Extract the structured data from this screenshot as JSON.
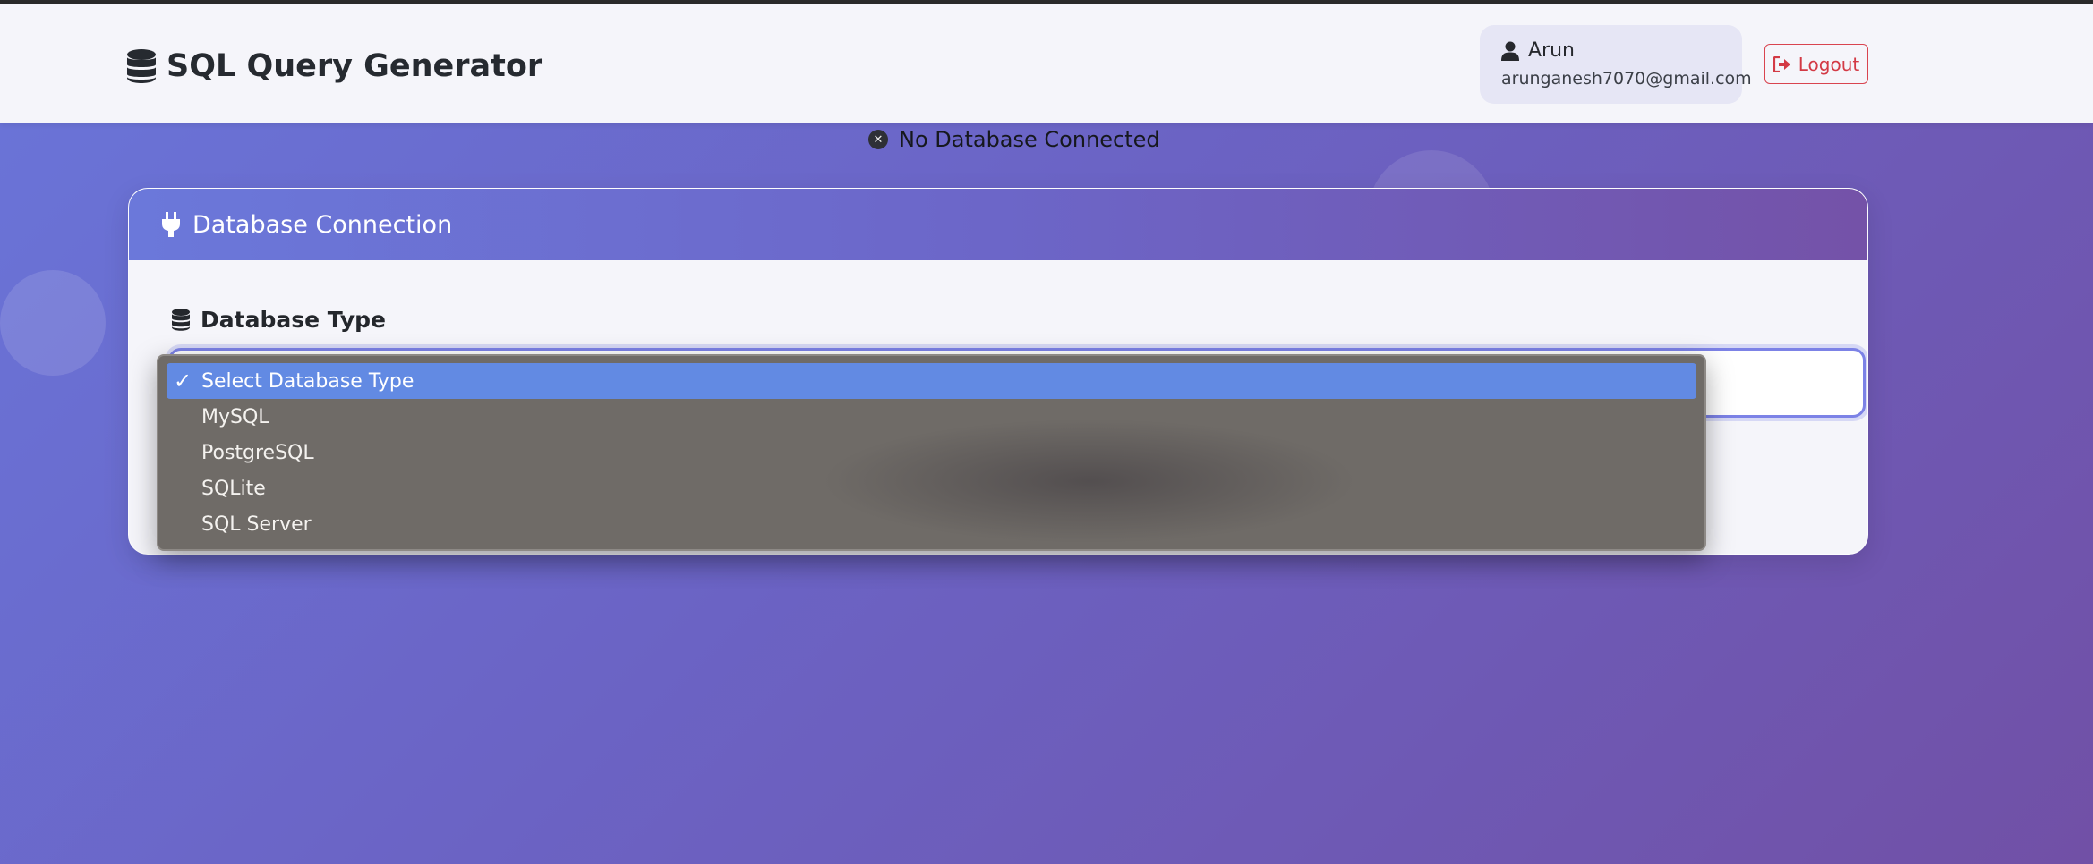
{
  "header": {
    "brand_icon": "database-icon",
    "title": "SQL Query Generator",
    "user": {
      "icon": "user-icon",
      "name": "Arun",
      "email": "arunganesh7070@gmail.com"
    },
    "logout": {
      "icon": "sign-out-icon",
      "label": "Logout",
      "color": "#d33a45"
    }
  },
  "status": {
    "icon": "times-circle-icon",
    "text": "No Database Connected"
  },
  "connection_card": {
    "header_icon": "plug-icon",
    "title": "Database Connection",
    "database_type": {
      "icon": "database-icon",
      "label": "Database Type",
      "selected": "Select Database Type",
      "options": [
        {
          "label": "Select Database Type",
          "selected": true
        },
        {
          "label": "MySQL",
          "selected": false
        },
        {
          "label": "PostgreSQL",
          "selected": false
        },
        {
          "label": "SQLite",
          "selected": false
        },
        {
          "label": "SQL Server",
          "selected": false
        }
      ]
    }
  },
  "colors": {
    "accent": "#6b73d8",
    "highlight": "#628ae3",
    "danger": "#d33a45"
  }
}
